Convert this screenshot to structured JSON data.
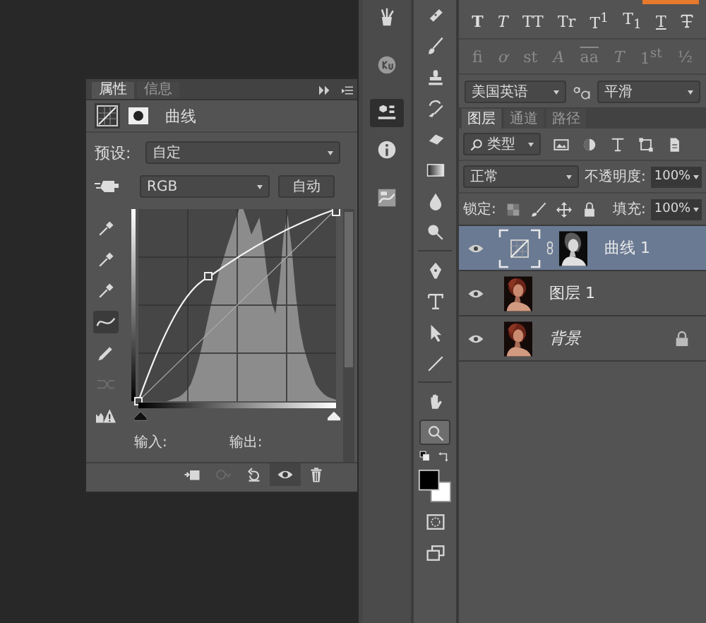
{
  "properties_panel": {
    "tabs": [
      {
        "label": "属性",
        "selected": true
      },
      {
        "label": "信息",
        "selected": false
      }
    ],
    "title": "曲线",
    "preset_label": "预设:",
    "preset": "自定",
    "channel": "RGB",
    "auto_button": "自动",
    "tools": [
      {
        "kind": "eyedropper",
        "selected": false,
        "disabled": false
      },
      {
        "kind": "eyedropper",
        "selected": false,
        "disabled": false
      },
      {
        "kind": "eyedropper",
        "selected": false,
        "disabled": false
      },
      {
        "kind": "curve",
        "selected": true,
        "disabled": false
      },
      {
        "kind": "pencil",
        "selected": false,
        "disabled": false
      },
      {
        "kind": "smooth",
        "selected": false,
        "disabled": true
      },
      {
        "kind": "clip-warning",
        "selected": false,
        "disabled": false
      }
    ],
    "input_label": "输入:",
    "output_label": "输出:",
    "bottom_buttons": [
      {
        "kind": "clip",
        "selected": false,
        "disabled": false
      },
      {
        "kind": "view-previous",
        "selected": false,
        "disabled": true
      },
      {
        "kind": "reset",
        "selected": false,
        "disabled": false
      },
      {
        "kind": "visibility",
        "selected": true,
        "disabled": false
      },
      {
        "kind": "delete",
        "selected": false,
        "disabled": false
      }
    ]
  },
  "dock": [
    {
      "kind": "tool-presets",
      "selected": false
    },
    {
      "kind": "ku",
      "selected": false
    },
    {
      "kind": "cube",
      "selected": true
    },
    {
      "kind": "info",
      "selected": false
    },
    {
      "kind": "ribbon",
      "selected": false
    }
  ],
  "toolbar": [
    {
      "tools": [
        {
          "kind": "healing",
          "selected": false
        },
        {
          "kind": "brush",
          "selected": false
        },
        {
          "kind": "stamp",
          "selected": false
        },
        {
          "kind": "history",
          "selected": false
        },
        {
          "kind": "eraser",
          "selected": false
        },
        {
          "kind": "gradient",
          "selected": false
        },
        {
          "kind": "drop",
          "selected": false
        },
        {
          "kind": "dodge",
          "selected": false
        }
      ]
    },
    {
      "tools": [
        {
          "kind": "pen",
          "selected": false
        },
        {
          "kind": "type",
          "selected": false
        },
        {
          "kind": "select",
          "selected": false
        },
        {
          "kind": "line",
          "selected": false
        }
      ]
    },
    {
      "tools": [
        {
          "kind": "hand",
          "selected": false
        },
        {
          "kind": "zoom",
          "selected": true
        }
      ]
    }
  ],
  "character": {
    "styles": [
      {
        "text": "T",
        "kind": "bold"
      },
      {
        "text": "T",
        "kind": "italic"
      },
      {
        "text": "TT",
        "kind": "plain"
      },
      {
        "text": "Tr",
        "kind": "plain"
      },
      {
        "text": "T$^{1}$",
        "kind": "plain"
      },
      {
        "text": "T$_{1}$",
        "kind": "plain"
      },
      {
        "text": "T",
        "kind": "underline"
      },
      {
        "kind": "strike"
      }
    ],
    "opentype": [
      {
        "text": "fi",
        "kind": "plain",
        "disabled": true
      },
      {
        "text": "ơ",
        "kind": "italic",
        "disabled": true
      },
      {
        "text": "st",
        "kind": "plain",
        "disabled": true
      },
      {
        "text": "A",
        "kind": "italic",
        "disabled": true
      },
      {
        "text": "aa",
        "kind": "overline",
        "disabled": true
      },
      {
        "text": "T",
        "kind": "italic",
        "disabled": true
      },
      {
        "text": "1$^{st}$",
        "kind": "plain",
        "disabled": true
      },
      {
        "text": "½",
        "kind": "plain",
        "disabled": true
      }
    ],
    "language": "美国英语",
    "antialias": "平滑"
  },
  "layers_panel": {
    "tabs": [
      {
        "label": "图层",
        "selected": true
      },
      {
        "label": "通道",
        "selected": false
      },
      {
        "label": "路径",
        "selected": false
      }
    ],
    "filter": "类型",
    "blend_mode": "正常",
    "opacity_label": "不透明度:",
    "opacity": "100%",
    "lock_label": "锁定:",
    "fill_label": "填充:",
    "fill": "100%",
    "layers": [
      {
        "name": "曲线 1",
        "kind": "adjustment",
        "selected": true,
        "visible": true,
        "locked": false
      },
      {
        "name": "图层 1",
        "kind": "pixel",
        "selected": false,
        "visible": true,
        "locked": false
      },
      {
        "name": "背景",
        "kind": "background",
        "selected": false,
        "visible": true,
        "locked": true
      }
    ]
  }
}
